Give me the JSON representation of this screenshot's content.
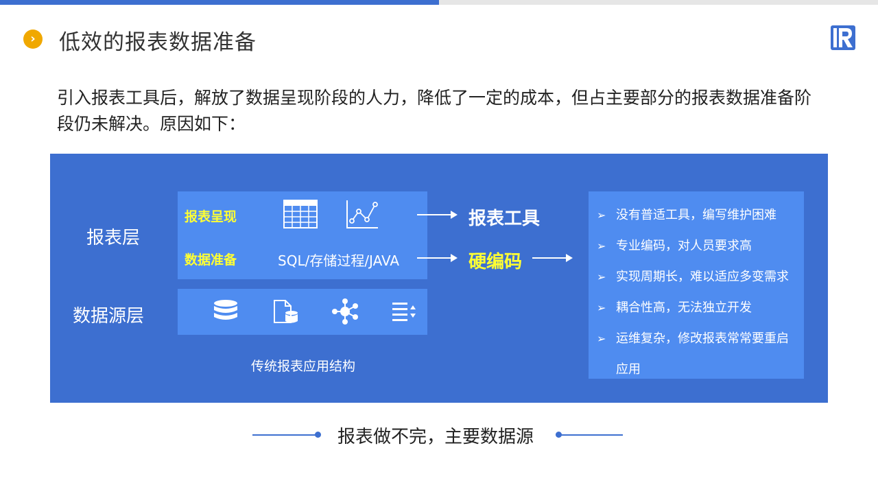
{
  "header": {
    "title": "低效的报表数据准备",
    "bullet_icon": "chevron-right-icon",
    "logo_icon": "r-logo-icon",
    "accent_color": "#3d6fd0",
    "bullet_color": "#f0a800"
  },
  "intro": "引入报表工具后，解放了数据呈现阶段的人力，降低了一定的成本，但占主要部分的报表数据准备阶段仍未解决。原因如下：",
  "diagram": {
    "report_layer_label": "报表层",
    "data_source_layer_label": "数据源层",
    "report_present_label": "报表呈现",
    "data_prep_label": "数据准备",
    "data_prep_tech": "SQL/存储过程/JAVA",
    "report_present_icons": [
      "table-icon",
      "line-chart-icon"
    ],
    "data_source_icons": [
      "database-icon",
      "file-database-icon",
      "network-icon",
      "sort-list-icon"
    ],
    "report_tool": "报表工具",
    "hard_coding": "硬编码",
    "caption": "传统报表应用结构",
    "panel_color": "#3d6fd0",
    "box_color": "#4f8cf0",
    "highlight_color": "#ffff33"
  },
  "issues": {
    "items": [
      "没有普适工具，编写维护困难",
      "专业编码，对人员要求高",
      "实现周期长，难以适应多变需求",
      "耦合性高，无法独立开发",
      "运维复杂，修改报表常常要重启"
    ],
    "last_item_continuation": "应用"
  },
  "conclusion": "报表做不完，主要数据源"
}
